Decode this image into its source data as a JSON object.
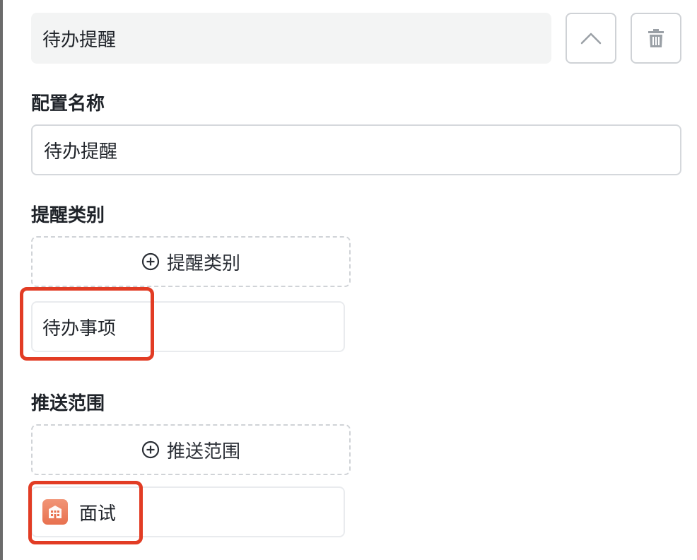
{
  "header": {
    "title_value": "待办提醒"
  },
  "icons": {
    "collapse": "chevron-up-icon",
    "delete": "trash-icon",
    "add": "plus-circle-icon",
    "scope_item": "building-icon"
  },
  "config_name": {
    "label": "配置名称",
    "value": "待办提醒"
  },
  "reminder_type": {
    "label": "提醒类别",
    "add_button_label": "提醒类别",
    "items": [
      "待办事项"
    ]
  },
  "push_scope": {
    "label": "推送范围",
    "add_button_label": "推送范围",
    "items": [
      "面试"
    ]
  },
  "colors": {
    "highlight": "#e23c24",
    "icon_tile": "#e8714f",
    "header_bg": "#f3f4f4"
  }
}
